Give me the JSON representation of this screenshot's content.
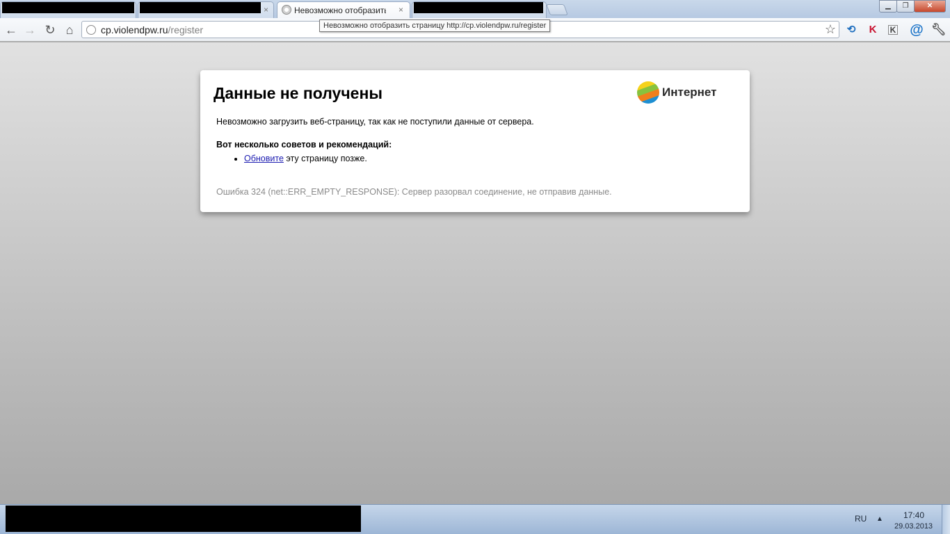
{
  "browser": {
    "active_tab_title": "Невозможно отобразить с",
    "tooltip": "Невозможно отобразить страницу http://cp.violendpw.ru/register",
    "url_host": "cp.violendpw.ru",
    "url_path": "/register",
    "close_glyph": "×"
  },
  "error_page": {
    "title": "Данные не получены",
    "brand": "Интернет",
    "message": "Невозможно загрузить веб-страницу, так как не поступили данные от сервера.",
    "tips_heading": "Вот несколько советов и рекомендаций:",
    "tip_link": "Обновите",
    "tip_rest": " эту страницу позже.",
    "error_code": "Ошибка 324 (net::ERR_EMPTY_RESPONSE): Сервер разорвал соединение, не отправив данные."
  },
  "taskbar": {
    "lang": "RU",
    "time": "17:40",
    "date": "29.03.2013"
  },
  "icons": [
    "back-icon",
    "forward-icon",
    "reload-icon",
    "home-icon",
    "globe-icon",
    "star-icon",
    "wrench-icon"
  ]
}
